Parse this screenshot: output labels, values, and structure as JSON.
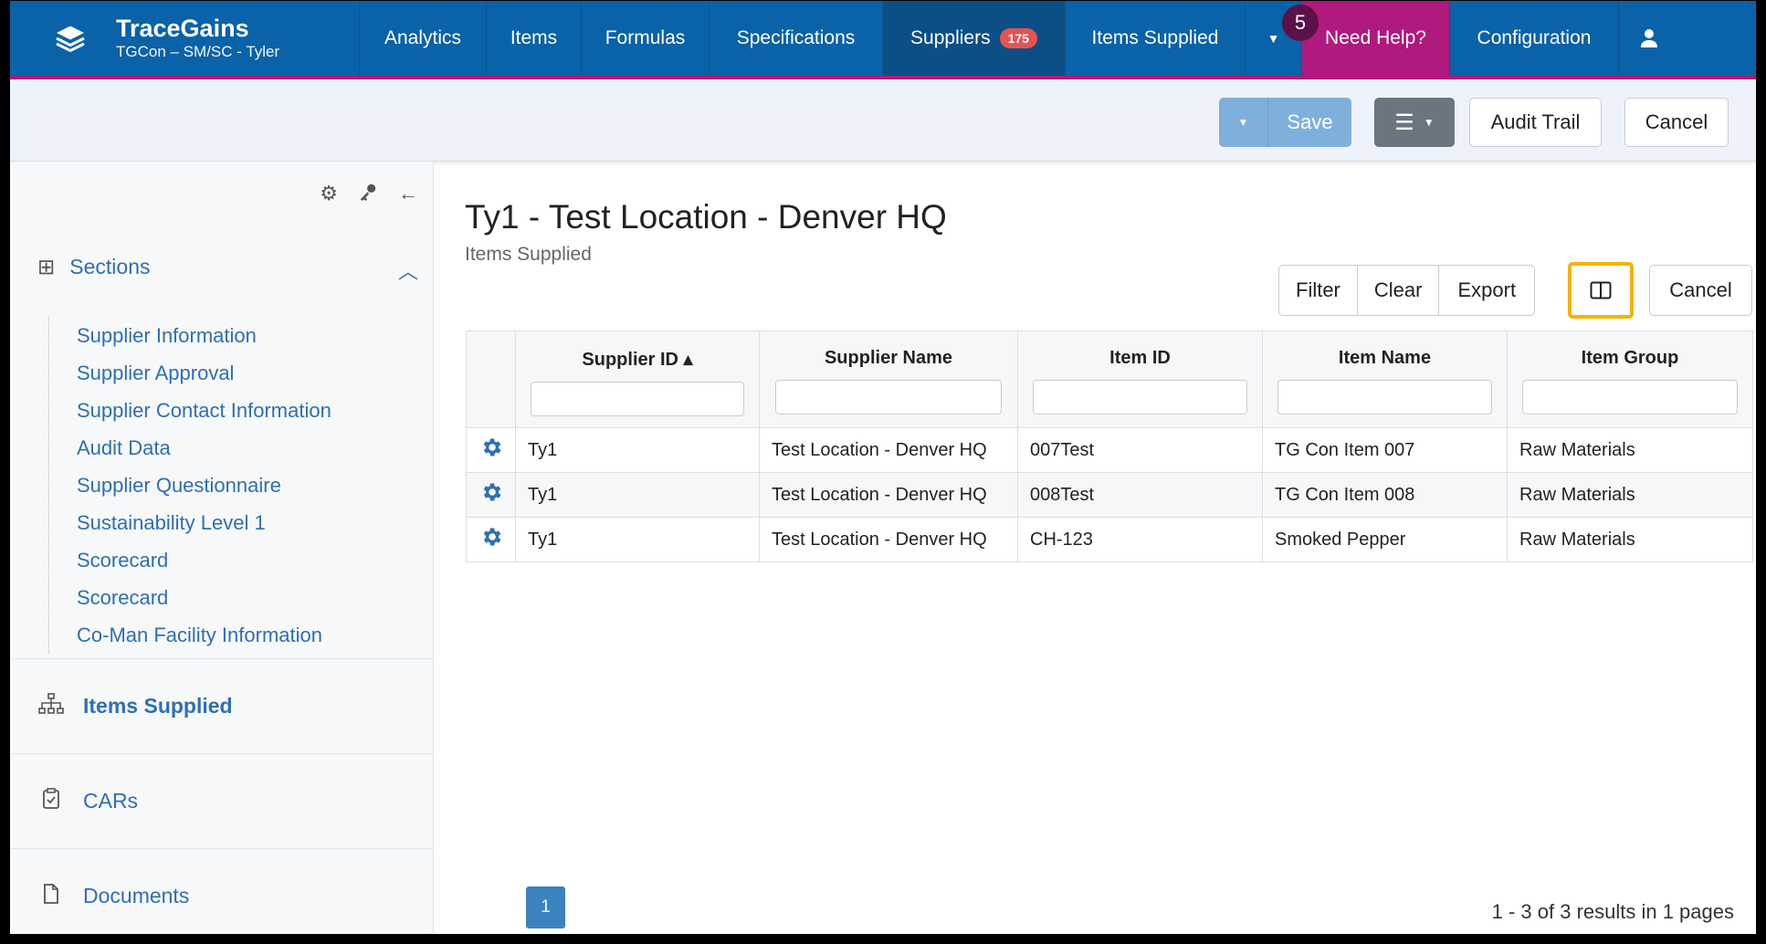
{
  "brand": {
    "name": "TraceGains",
    "subtitle": "TGCon – SM/SC - Tyler"
  },
  "nav": {
    "items": [
      "Analytics",
      "Items",
      "Formulas",
      "Specifications",
      "Suppliers",
      "Items Supplied"
    ],
    "suppliers_badge": "175",
    "help_label": "Need Help?",
    "help_count": "5",
    "config_label": "Configuration"
  },
  "toolbar": {
    "save_label": "Save",
    "audit_label": "Audit Trail",
    "cancel_label": "Cancel"
  },
  "sidebar": {
    "sections_label": "Sections",
    "sections": [
      "Supplier Information",
      "Supplier Approval",
      "Supplier Contact Information",
      "Audit Data",
      "Supplier Questionnaire",
      "Sustainability Level 1",
      "Scorecard",
      "Scorecard",
      "Co-Man Facility Information"
    ],
    "items": [
      "Items Supplied",
      "CARs",
      "Documents"
    ]
  },
  "page": {
    "title": "Ty1 - Test Location - Denver HQ",
    "subtitle": "Items Supplied"
  },
  "grid_toolbar": {
    "filter": "Filter",
    "clear": "Clear",
    "export": "Export",
    "cancel": "Cancel"
  },
  "table": {
    "headers": [
      "Supplier ID ▴",
      "Supplier Name",
      "Item ID",
      "Item Name",
      "Item Group"
    ],
    "rows": [
      [
        "Ty1",
        "Test Location - Denver HQ",
        "007Test",
        "TG Con Item 007",
        "Raw Materials"
      ],
      [
        "Ty1",
        "Test Location - Denver HQ",
        "008Test",
        "TG Con Item 008",
        "Raw Materials"
      ],
      [
        "Ty1",
        "Test Location - Denver HQ",
        "CH-123",
        "Smoked Pepper",
        "Raw Materials"
      ]
    ]
  },
  "pagination": {
    "page": "1",
    "summary": "1 - 3 of 3 results in 1 pages"
  },
  "colors": {
    "nav": "#0a62a8",
    "help": "#b0197d",
    "link": "#2e6fb3",
    "highlight": "#f4b400"
  }
}
